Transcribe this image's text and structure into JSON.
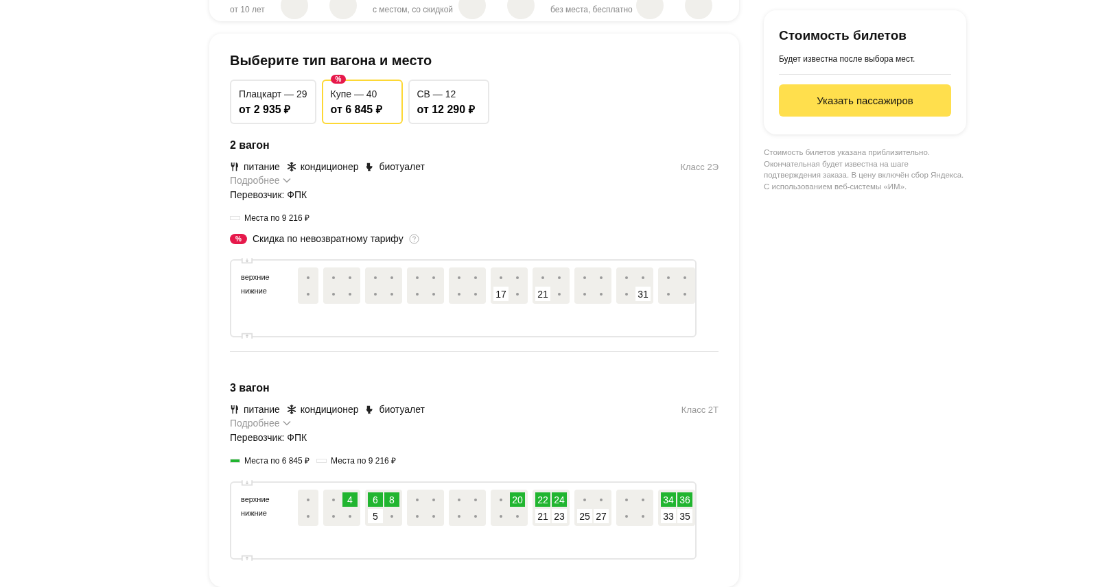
{
  "passengers": [
    {
      "label": "от 10 лет"
    },
    {
      "label": "с местом, со скидкой"
    },
    {
      "label": "без места, бесплатно"
    }
  ],
  "heading": "Выберите тип вагона и место",
  "car_types": [
    {
      "name": "Плацкарт — 29",
      "price": "от 2 935 ₽",
      "selected": false
    },
    {
      "name": "Купе — 40",
      "price": "от 6 845 ₽",
      "selected": true,
      "badge": "%"
    },
    {
      "name": "СВ — 12",
      "price": "от 12 290 ₽",
      "selected": false
    }
  ],
  "wagons": [
    {
      "title": "2 вагон",
      "amenities": [
        {
          "kind": "food",
          "label": "питание"
        },
        {
          "kind": "ac",
          "label": "кондиционер"
        },
        {
          "kind": "wc",
          "label": "биотуалет"
        }
      ],
      "class": "Класс 2Э",
      "more": "Подробнее",
      "carrier": "Перевозчик: ФПК",
      "legend": [
        {
          "label": "Места по 9 216 ₽",
          "color": "#ffffff"
        }
      ],
      "discount": {
        "badge": "%",
        "text": "Скидка по невозвратному тарифу"
      },
      "row_labels": [
        "верхние",
        "нижние"
      ],
      "compartments": [
        {
          "upper": [
            {
              "kind": "taken"
            }
          ],
          "lower": [
            {
              "kind": "taken"
            }
          ]
        },
        {
          "upper": [
            {
              "kind": "taken"
            },
            {
              "kind": "taken"
            }
          ],
          "lower": [
            {
              "kind": "taken"
            },
            {
              "kind": "taken"
            }
          ]
        },
        {
          "upper": [
            {
              "kind": "taken"
            },
            {
              "kind": "taken"
            }
          ],
          "lower": [
            {
              "kind": "taken"
            },
            {
              "kind": "taken"
            }
          ]
        },
        {
          "upper": [
            {
              "kind": "taken"
            },
            {
              "kind": "taken"
            }
          ],
          "lower": [
            {
              "kind": "taken"
            },
            {
              "kind": "taken"
            }
          ]
        },
        {
          "upper": [
            {
              "kind": "taken"
            },
            {
              "kind": "taken"
            }
          ],
          "lower": [
            {
              "kind": "taken"
            },
            {
              "kind": "taken"
            }
          ]
        },
        {
          "upper": [
            {
              "kind": "taken"
            },
            {
              "kind": "taken"
            }
          ],
          "lower": [
            {
              "kind": "seat",
              "number": "17",
              "color": "#ffffff"
            },
            {
              "kind": "taken"
            }
          ]
        },
        {
          "upper": [
            {
              "kind": "taken"
            },
            {
              "kind": "taken"
            }
          ],
          "lower": [
            {
              "kind": "seat",
              "number": "21",
              "color": "#ffffff"
            },
            {
              "kind": "taken"
            }
          ]
        },
        {
          "upper": [
            {
              "kind": "taken"
            },
            {
              "kind": "taken"
            }
          ],
          "lower": [
            {
              "kind": "taken"
            },
            {
              "kind": "taken"
            }
          ]
        },
        {
          "upper": [
            {
              "kind": "taken"
            },
            {
              "kind": "taken"
            }
          ],
          "lower": [
            {
              "kind": "taken"
            },
            {
              "kind": "seat",
              "number": "31",
              "color": "#ffffff"
            }
          ]
        },
        {
          "upper": [
            {
              "kind": "taken"
            },
            {
              "kind": "taken"
            }
          ],
          "lower": [
            {
              "kind": "taken"
            },
            {
              "kind": "taken"
            }
          ]
        }
      ]
    },
    {
      "title": "3 вагон",
      "amenities": [
        {
          "kind": "food",
          "label": "питание"
        },
        {
          "kind": "ac",
          "label": "кондиционер"
        },
        {
          "kind": "wc",
          "label": "биотуалет"
        }
      ],
      "class": "Класс 2Т",
      "more": "Подробнее",
      "carrier": "Перевозчик: ФПК",
      "legend": [
        {
          "label": "Места по 6 845 ₽",
          "color": "#21b530"
        },
        {
          "label": "Места по 9 216 ₽",
          "color": "#ffffff"
        }
      ],
      "row_labels": [
        "верхние",
        "нижние"
      ],
      "compartments": [
        {
          "upper": [
            {
              "kind": "taken"
            }
          ],
          "lower": [
            {
              "kind": "taken"
            }
          ]
        },
        {
          "upper": [
            {
              "kind": "taken"
            },
            {
              "kind": "seat",
              "number": "4",
              "color": "#21b530"
            }
          ],
          "lower": [
            {
              "kind": "taken"
            },
            {
              "kind": "taken"
            }
          ]
        },
        {
          "upper": [
            {
              "kind": "seat",
              "number": "6",
              "color": "#21b530"
            },
            {
              "kind": "seat",
              "number": "8",
              "color": "#21b530"
            }
          ],
          "lower": [
            {
              "kind": "seat",
              "number": "5",
              "color": "#ffffff"
            },
            {
              "kind": "taken"
            }
          ]
        },
        {
          "upper": [
            {
              "kind": "taken"
            },
            {
              "kind": "taken"
            }
          ],
          "lower": [
            {
              "kind": "taken"
            },
            {
              "kind": "taken"
            }
          ]
        },
        {
          "upper": [
            {
              "kind": "taken"
            },
            {
              "kind": "taken"
            }
          ],
          "lower": [
            {
              "kind": "taken"
            },
            {
              "kind": "taken"
            }
          ]
        },
        {
          "upper": [
            {
              "kind": "taken"
            },
            {
              "kind": "seat",
              "number": "20",
              "color": "#21b530"
            }
          ],
          "lower": [
            {
              "kind": "taken"
            },
            {
              "kind": "taken"
            }
          ]
        },
        {
          "upper": [
            {
              "kind": "seat",
              "number": "22",
              "color": "#21b530"
            },
            {
              "kind": "seat",
              "number": "24",
              "color": "#21b530"
            }
          ],
          "lower": [
            {
              "kind": "seat",
              "number": "21",
              "color": "#ffffff"
            },
            {
              "kind": "seat",
              "number": "23",
              "color": "#ffffff"
            }
          ]
        },
        {
          "upper": [
            {
              "kind": "taken"
            },
            {
              "kind": "taken"
            }
          ],
          "lower": [
            {
              "kind": "seat",
              "number": "25",
              "color": "#ffffff"
            },
            {
              "kind": "seat",
              "number": "27",
              "color": "#ffffff"
            }
          ]
        },
        {
          "upper": [
            {
              "kind": "taken"
            },
            {
              "kind": "taken"
            }
          ],
          "lower": [
            {
              "kind": "taken"
            },
            {
              "kind": "taken"
            }
          ]
        },
        {
          "upper": [
            {
              "kind": "seat",
              "number": "34",
              "color": "#21b530"
            },
            {
              "kind": "seat",
              "number": "36",
              "color": "#21b530"
            }
          ],
          "lower": [
            {
              "kind": "seat",
              "number": "33",
              "color": "#ffffff"
            },
            {
              "kind": "seat",
              "number": "35",
              "color": "#ffffff"
            }
          ]
        }
      ]
    }
  ],
  "price_panel": {
    "title": "Стоимость билетов",
    "subtitle": "Будет известна после выбора мест.",
    "button": "Указать пассажиров",
    "note": "Стоимость билетов указана приблизительно. Окончательная будет известна на шаге подтверждения заказа. В цену включён сбор Яндекса. С использованием веб-системы «ИМ»."
  }
}
